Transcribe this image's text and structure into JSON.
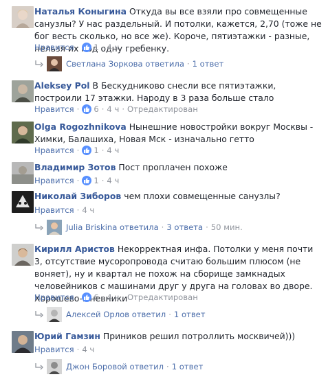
{
  "labels": {
    "like": "Нравится",
    "dot": "·",
    "edited": "Отредактирован",
    "replied": "ответила",
    "replied_m": "ответил"
  },
  "comments": [
    {
      "author": "Наталья Коныгина",
      "text": "Откуда вы все взяли про совмещенные санузлы? У нас раздельный. И потолки, кажется, 2,70 (тоже не бог весть сколько, но все же). Короче, пятиэтажки - разные, нельзя их под одну гребенку.",
      "likes": "1",
      "time": "4 ч",
      "reply_author": "Светлана Зоркова ответила",
      "reply_count": "1 ответ"
    },
    {
      "author": "Aleksey Pol",
      "text": "В Бескудниково снесли все пятиэтажки, построили 17 этажки. Народу в 3 раза больше стало",
      "likes": "6",
      "time": "4 ч",
      "edited": "Отредактирован"
    },
    {
      "author": "Olga Rogozhnikova",
      "text": "Нынешние новостройки вокруг Москвы - Химки, Балашиха, Новая Мск - изначально гетто",
      "likes": "1",
      "time": "4 ч"
    },
    {
      "author": "Владимир Зотов",
      "text": "Пост проплачен похоже",
      "likes": "1",
      "time": "4 ч"
    },
    {
      "author": "Николай Зиборов",
      "text": "чем плохи совмещенные санузлы?",
      "time": "4 ч",
      "reply_author": "Julia Briskina ответила",
      "reply_count": "3 ответа",
      "reply_time": "50 мин."
    },
    {
      "author": "Кирилл Аристов",
      "text": "Некорректная инфа. Потолки у меня почти 3, отсутствие мусоропровода считаю большим плюсом (не воняет), ну и квартал не похож на сборище замкнадых человейников с машинами друг у друга на головах во дворе. Хорошево-Мневники",
      "likes": "6",
      "time": "4 ч",
      "edited": "Отредактирован",
      "reply_author": "Алексей Орлов ответил",
      "reply_count": "1 ответ"
    },
    {
      "author": "Юрий Гамзин",
      "text": "Приников решил потроллить москвичей)))",
      "time": "4 ч",
      "reply_author": "Джон Боровой ответил",
      "reply_count": "1 ответ"
    }
  ]
}
